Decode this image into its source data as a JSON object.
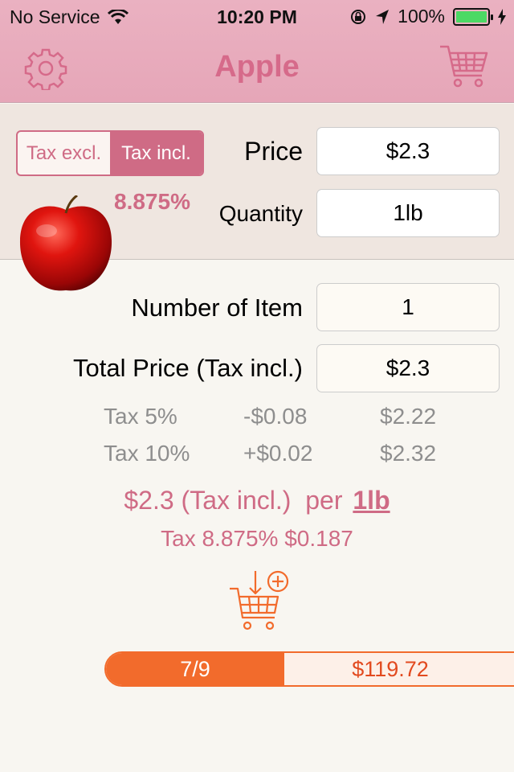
{
  "status_bar": {
    "carrier": "No Service",
    "time": "10:20 PM",
    "battery": "100%",
    "battery_fill": 1.0,
    "icons": [
      "wifi-icon",
      "rotation-lock-icon",
      "location-arrow-icon",
      "battery-icon",
      "charging-icon"
    ]
  },
  "nav": {
    "title": "Apple",
    "left_icon": "gear-icon",
    "right_icon": "shopping-cart-icon"
  },
  "tax_toggle": {
    "options": [
      "Tax excl.",
      "Tax incl."
    ],
    "selected": "Tax incl."
  },
  "tax_rate": "8.875%",
  "product_image": "apple-icon",
  "fields": {
    "price_label": "Price",
    "price_value": "$2.3",
    "quantity_label": "Quantity",
    "quantity_value": "1lb",
    "number_label": "Number of Item",
    "number_value": "1",
    "total_label": "Total Price (Tax incl.)",
    "total_value": "$2.3"
  },
  "tax_comparisons": [
    {
      "label": "Tax 5%",
      "diff": "-$0.08",
      "price": "$2.22"
    },
    {
      "label": "Tax 10%",
      "diff": "+$0.02",
      "price": "$2.32"
    }
  ],
  "summary": {
    "price_text": "$2.3 (Tax incl.)",
    "per_text": "per",
    "unit_link": "1lb",
    "tax_line": "Tax 8.875% $0.187"
  },
  "add_to_cart_icon": "add-to-cart-icon",
  "progress": {
    "count": "7/9",
    "fraction": 0.778,
    "total": "$119.72"
  },
  "colors": {
    "accent_pink": "#cf6b85",
    "nav_bg": "#e8adbe",
    "accent_orange": "#f26b2c"
  }
}
